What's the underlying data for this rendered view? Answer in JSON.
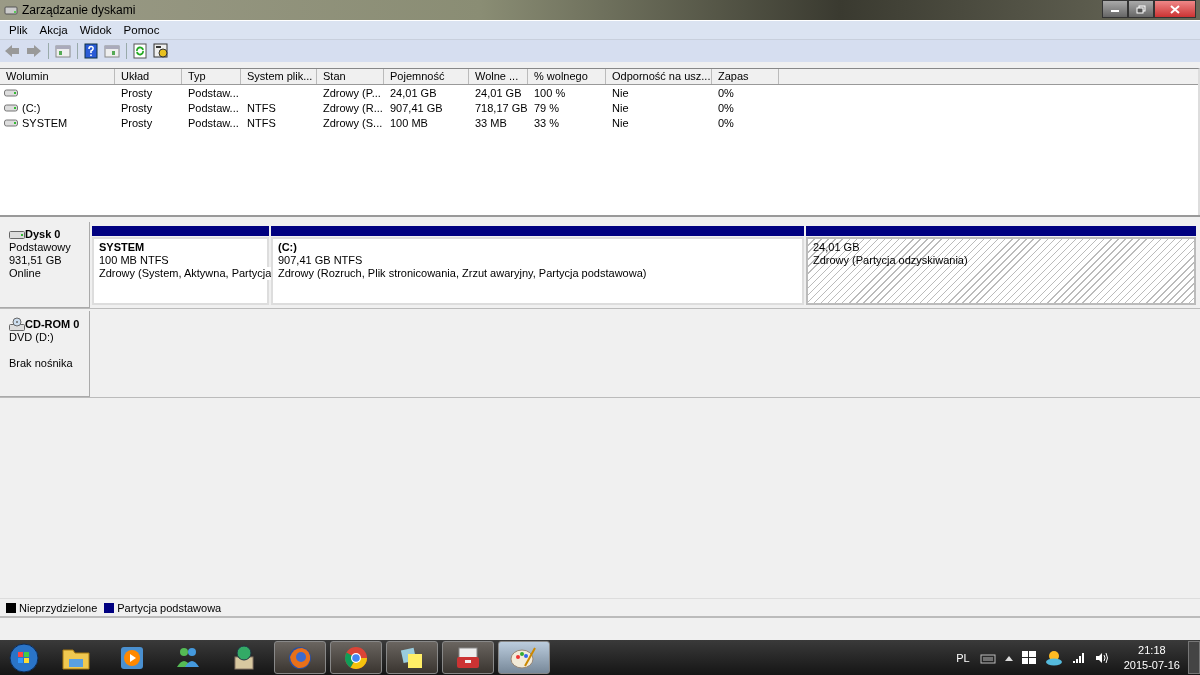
{
  "window": {
    "title": "Zarządzanie dyskami"
  },
  "menu": [
    "Plik",
    "Akcja",
    "Widok",
    "Pomoc"
  ],
  "volume_table": {
    "columns": [
      "Wolumin",
      "Układ",
      "Typ",
      "System plik...",
      "Stan",
      "Pojemność",
      "Wolne ...",
      "% wolnego",
      "Odporność na usz...",
      "Zapas"
    ],
    "rows": [
      {
        "cells": [
          "",
          "Prosty",
          "Podstaw...",
          "",
          "Zdrowy (P...",
          "24,01 GB",
          "24,01 GB",
          "100 %",
          "Nie",
          "0%"
        ]
      },
      {
        "cells": [
          "(C:)",
          "Prosty",
          "Podstaw...",
          "NTFS",
          "Zdrowy (R...",
          "907,41 GB",
          "718,17 GB",
          "79 %",
          "Nie",
          "0%"
        ]
      },
      {
        "cells": [
          "SYSTEM",
          "Prosty",
          "Podstaw...",
          "NTFS",
          "Zdrowy (S...",
          "100 MB",
          "33 MB",
          "33 %",
          "Nie",
          "0%"
        ]
      }
    ]
  },
  "disks": [
    {
      "kind": "disk",
      "name": "Dysk 0",
      "lines": [
        "Podstawowy",
        "931,51 GB"
      ],
      "status": "Online",
      "partitions": [
        {
          "name": "SYSTEM",
          "size": "100 MB NTFS",
          "status": "Zdrowy (System, Aktywna, Partycja",
          "color": "#000080",
          "selected": false
        },
        {
          "name": "(C:)",
          "size": "907,41 GB NTFS",
          "status": "Zdrowy (Rozruch, Plik stronicowania, Zrzut awaryjny, Partycja podstawowa)",
          "color": "#000080",
          "selected": false
        },
        {
          "size": "24,01 GB",
          "status": "Zdrowy (Partycja odzyskiwania)",
          "color": "#000080",
          "selected": true
        }
      ]
    },
    {
      "kind": "cdrom",
      "name": "CD-ROM 0",
      "lines": [
        "DVD (D:)"
      ],
      "status": "Brak nośnika"
    }
  ],
  "legend": [
    {
      "label": "Nieprzydzielone",
      "color": "#000000"
    },
    {
      "label": "Partycja podstawowa",
      "color": "#000080"
    }
  ],
  "taskbar": {
    "apps": [
      {
        "kind": "folder",
        "running": false,
        "selected": false
      },
      {
        "kind": "player",
        "running": false,
        "selected": false
      },
      {
        "kind": "messenger",
        "running": false,
        "selected": false
      },
      {
        "kind": "box",
        "running": false,
        "selected": false
      },
      {
        "kind": "firefox",
        "running": true,
        "selected": false
      },
      {
        "kind": "chrome",
        "running": true,
        "selected": false
      },
      {
        "kind": "notes",
        "running": true,
        "selected": false
      },
      {
        "kind": "toolbox",
        "running": true,
        "selected": false
      },
      {
        "kind": "paint",
        "running": true,
        "selected": true
      }
    ],
    "language": "PL",
    "time": "21:18",
    "date": "2015-07-16"
  }
}
